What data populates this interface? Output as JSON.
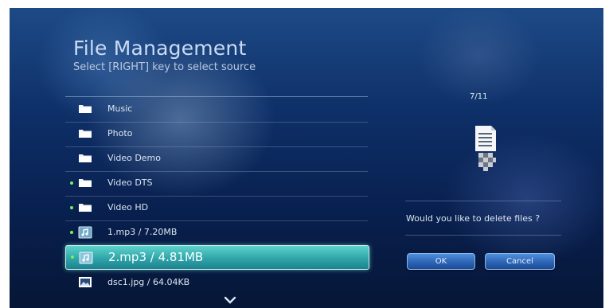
{
  "header": {
    "title": "File Management",
    "subtitle": "Select [RIGHT] key to select source"
  },
  "file_list": {
    "items": [
      {
        "label": "Music",
        "type": "folder",
        "marked": false,
        "selected": false
      },
      {
        "label": "Photo",
        "type": "folder",
        "marked": false,
        "selected": false
      },
      {
        "label": "Video Demo",
        "type": "folder",
        "marked": false,
        "selected": false
      },
      {
        "label": "Video DTS",
        "type": "folder",
        "marked": true,
        "selected": false
      },
      {
        "label": "Video HD",
        "type": "folder",
        "marked": true,
        "selected": false
      },
      {
        "label": "1.mp3 / 7.20MB",
        "type": "audio",
        "marked": true,
        "selected": false
      },
      {
        "label": "2.mp3 / 4.81MB",
        "type": "audio",
        "marked": true,
        "selected": true
      },
      {
        "label": "dsc1.jpg / 64.04KB",
        "type": "image",
        "marked": false,
        "selected": false
      }
    ]
  },
  "right_panel": {
    "counter": "7/11",
    "file_icon": "document-delete-icon",
    "question": "Would you like to delete files ?",
    "ok_label": "OK",
    "cancel_label": "Cancel"
  },
  "navigation": {
    "scroll_icon": "chevron-down-icon"
  },
  "colors": {
    "background": "#0e2f68",
    "selection": "#3fb8b8",
    "marker": "#7cf05a",
    "button": "#2d65b6"
  }
}
